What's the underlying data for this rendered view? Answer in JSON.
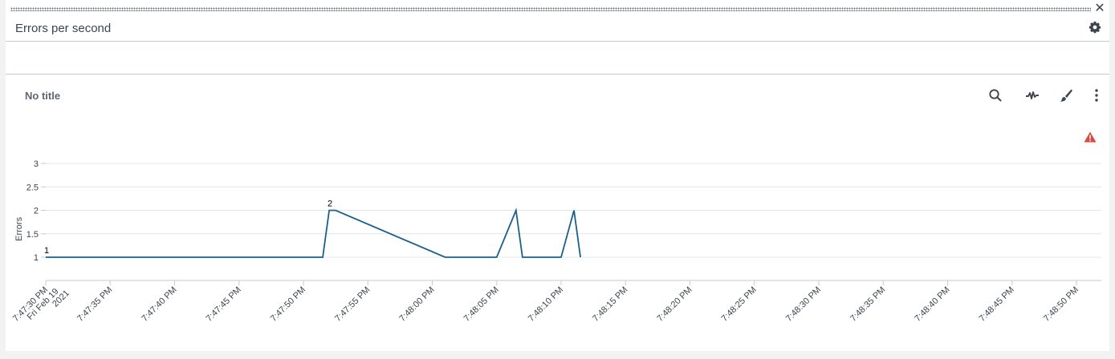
{
  "panel": {
    "title": "Errors per second",
    "viz_title": "No title"
  },
  "icons": {
    "close": "close-icon",
    "settings": "gear-icon",
    "search": "search-icon",
    "pulse": "activity-icon",
    "format": "paintbrush-icon",
    "more": "more-vertical-icon",
    "warning": "warning-triangle-icon"
  },
  "colors": {
    "series": "#1b5f8c",
    "warning": "#d94b3a"
  },
  "chart_data": {
    "type": "line",
    "title": "",
    "xlabel": "",
    "ylabel": "Errors",
    "ylim": [
      1,
      3
    ],
    "yticks": [
      "1",
      "1.5",
      "2",
      "2.5",
      "3"
    ],
    "xticks": [
      "7:47:30 PM\nFri Feb 19\n2021",
      "7:47:35 PM",
      "7:47:40 PM",
      "7:47:45 PM",
      "7:47:50 PM",
      "7:47:55 PM",
      "7:48:00 PM",
      "7:48:05 PM",
      "7:48:10 PM",
      "7:48:15 PM",
      "7:48:20 PM",
      "7:48:25 PM",
      "7:48:30 PM",
      "7:48:35 PM",
      "7:48:40 PM",
      "7:48:45 PM",
      "7:48:50 PM"
    ],
    "series": [
      {
        "x": [
          0,
          21.5,
          22,
          22.5,
          31,
          35,
          36.5,
          37,
          40,
          41,
          41.5
        ],
        "values": [
          1,
          1,
          2,
          2,
          1,
          1,
          2,
          1,
          1,
          2,
          1
        ]
      }
    ],
    "data_labels": [
      {
        "x": 0,
        "y": 1,
        "text": "1"
      },
      {
        "x": 22,
        "y": 2,
        "text": "2"
      }
    ],
    "grid": true
  }
}
